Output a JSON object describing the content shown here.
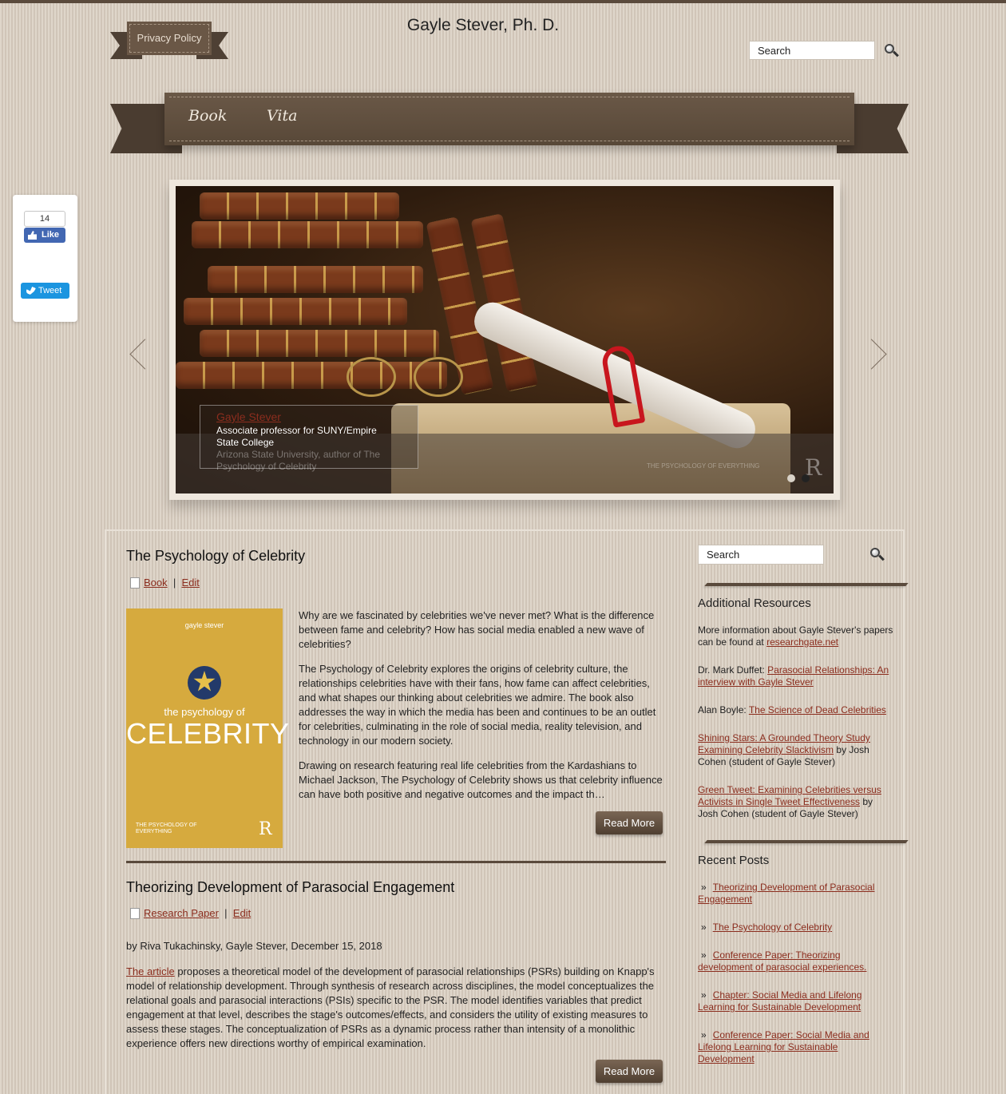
{
  "header": {
    "privacy_label": "Privacy Policy",
    "site_title": "Gayle Stever, Ph. D.",
    "search_placeholder": "Search"
  },
  "nav": {
    "items": [
      "Book",
      "Vita"
    ]
  },
  "social": {
    "like_count": "14",
    "like_label": "Like",
    "tweet_label": "Tweet"
  },
  "slider": {
    "caption_title": "Gayle Stever",
    "caption_text": "Associate professor for SUNY/Empire State College",
    "caption_overlap": "Arizona State University, author of The Psychology of Celebrity",
    "watermark": "THE PSYCHOLOGY OF EVERYTHING",
    "watermark_logo": "R",
    "active_slide": 2,
    "total_slides": 2
  },
  "posts": [
    {
      "title": "The Psychology of Celebrity",
      "category": "Book",
      "edit_label": "Edit",
      "cover": {
        "author": "gayle stever",
        "subtitle": "the psychology of",
        "main": "CELEBRITY",
        "series": "THE PSYCHOLOGY OF EVERYTHING",
        "logo": "R"
      },
      "paragraphs": [
        "Why are we fascinated by celebrities we've never met? What is the difference between fame and celebrity? How has social media enabled a new wave of celebrities?",
        "The Psychology of Celebrity explores the origins of celebrity culture, the relationships celebrities have with their fans, how fame can affect celebrities, and what shapes our thinking about celebrities we admire. The book also addresses the way in which the media has been and continues to be an outlet for celebrities, culminating in the role of social media, reality television, and technology in our modern society.",
        "Drawing on research featuring real life celebrities from the Kardashians to Michael Jackson, The Psychology of Celebrity shows us that celebrity influence can have both positive and negative outcomes and the impact th…"
      ],
      "read_more": "Read More"
    },
    {
      "title": "Theorizing Development of Parasocial Engagement",
      "category": "Research Paper",
      "edit_label": "Edit",
      "byline": "by Riva Tukachinsky, Gayle Stever, December 15, 2018",
      "article_link": "The article",
      "body": " proposes a theoretical model of the development of parasocial relationships (PSRs) building on Knapp's model of relationship development. Through synthesis of research across disciplines, the model conceptualizes the relational goals and parasocial interactions (PSIs) specific to the PSR. The model identifies variables that predict engagement at that level, describes the stage's outcomes/effects, and considers the utility of existing measures to assess these stages. The conceptualization of PSRs as a dynamic process rather than intensity of a monolithic experience offers new directions worthy of empirical examination.",
      "read_more": "Read More"
    }
  ],
  "sidebar": {
    "search_placeholder": "Search",
    "resources_heading": "Additional Resources",
    "resources": [
      {
        "pre": "More information about Gayle Stever's papers can be found at ",
        "link": "researchgate.net",
        "post": ""
      },
      {
        "pre": "Dr. Mark Duffet: ",
        "link": "Parasocial Relationships: An interview with Gayle Stever",
        "post": ""
      },
      {
        "pre": "Alan Boyle: ",
        "link": "The Science of Dead Celebrities",
        "post": ""
      },
      {
        "pre": "",
        "link": "Shining Stars: A Grounded Theory Study Examining Celebrity Slacktivism",
        "post": " by Josh Cohen (student of Gayle Stever)"
      },
      {
        "pre": "",
        "link": "Green Tweet: Examining Celebrities versus Activists in Single Tweet Effectiveness",
        "post": " by Josh Cohen (student of Gayle Stever)"
      }
    ],
    "recent_heading": "Recent Posts",
    "recent": [
      "Theorizing Development of Parasocial Engagement",
      "The Psychology of Celebrity",
      "Conference Paper: Theorizing development of parasocial experiences.",
      "Chapter: Social Media and Lifelong Learning for Sustainable Development",
      "Conference Paper: Social Media and Lifelong Learning for Sustainable Development"
    ],
    "bullet": "»"
  }
}
